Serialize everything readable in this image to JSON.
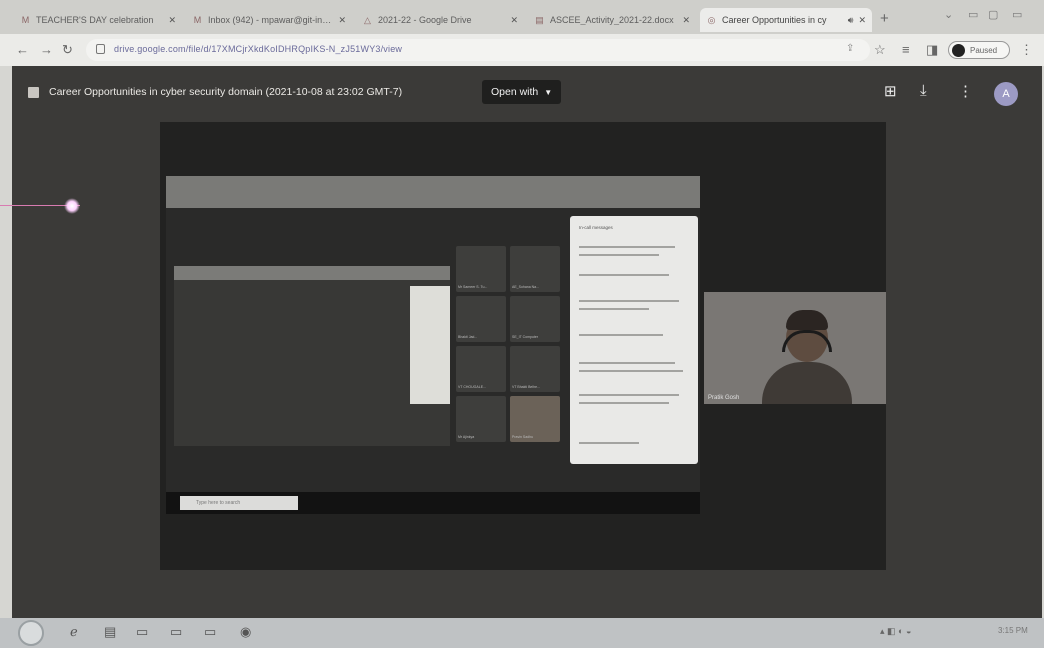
{
  "browser": {
    "tabs": [
      {
        "title": "TEACHER'S DAY celebration",
        "favicon": "M",
        "active": false
      },
      {
        "title": "Inbox (942) - mpawar@git-india",
        "favicon": "M",
        "active": false
      },
      {
        "title": "2021-22 - Google Drive",
        "favicon": "△",
        "active": false
      },
      {
        "title": "ASCEE_Activity_2021-22.docx",
        "favicon": "▤",
        "active": false
      },
      {
        "title": "Career Opportunities in cy",
        "favicon": "◎",
        "active": true
      }
    ],
    "url": "drive.google.com/file/d/17XMCjrXkdKoIDHRQpIKS-N_zJ51WY3/view",
    "profile_label": "Paused"
  },
  "viewer": {
    "file_title": "Career Opportunities in cyber security domain (2021-10-08 at 23:02 GMT-7)",
    "open_with_label": "Open with",
    "avatar_letter": "A"
  },
  "recording": {
    "chat_title": "In-call messages",
    "participants": [
      "Mr Sameer S. Tu...",
      "AE_Sohana Na...",
      "Bhakti Jad...",
      "SE_IT Computer",
      "VT CHOUGALE...",
      "VT Bhakti Belhe...",
      "Mr Ajinkya",
      "Pravin Sadhu"
    ],
    "search_placeholder": "Type here to search",
    "camera_name": "Pratik Gosh"
  },
  "taskbar": {
    "clock": "3:15 PM"
  }
}
